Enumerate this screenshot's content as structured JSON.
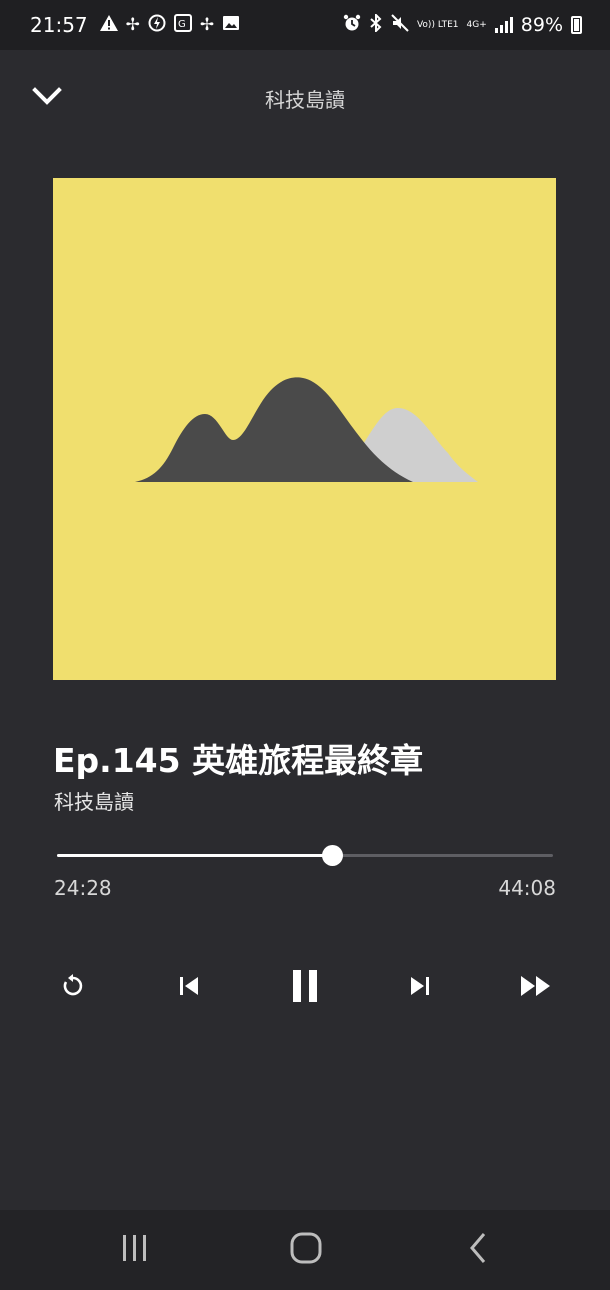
{
  "status_bar": {
    "time": "21:57",
    "battery": "89%",
    "left_icons": [
      "warning-icon",
      "fan-icon",
      "messenger-icon",
      "translate-icon",
      "fan-icon",
      "image-icon"
    ],
    "right_icons": [
      "alarm-icon",
      "bluetooth-icon",
      "mute-icon",
      "volte-icon",
      "4g-icon",
      "signal-icon",
      "battery-icon"
    ],
    "volte_label": "Vo)) LTE1",
    "network_label": "4G+"
  },
  "header": {
    "title": "科技島讀",
    "collapse_icon": "chevron-down-icon"
  },
  "artwork": {
    "background": "#f0df6e",
    "dark_mountain": "#4a4a4a",
    "light_mountain": "#cfcfcf"
  },
  "episode": {
    "title": "Ep.145 英雄旅程最終章",
    "podcast": "科技島讀"
  },
  "playback": {
    "elapsed": "24:28",
    "duration": "44:08",
    "progress_fraction": 0.555
  },
  "controls": {
    "replay_icon": "replay-icon",
    "previous_icon": "skip-previous-icon",
    "pause_icon": "pause-icon",
    "next_icon": "skip-next-icon",
    "fast_forward_icon": "fast-forward-icon"
  },
  "nav_bar": {
    "recents_icon": "recents-icon",
    "home_icon": "home-icon",
    "back_icon": "back-icon"
  }
}
